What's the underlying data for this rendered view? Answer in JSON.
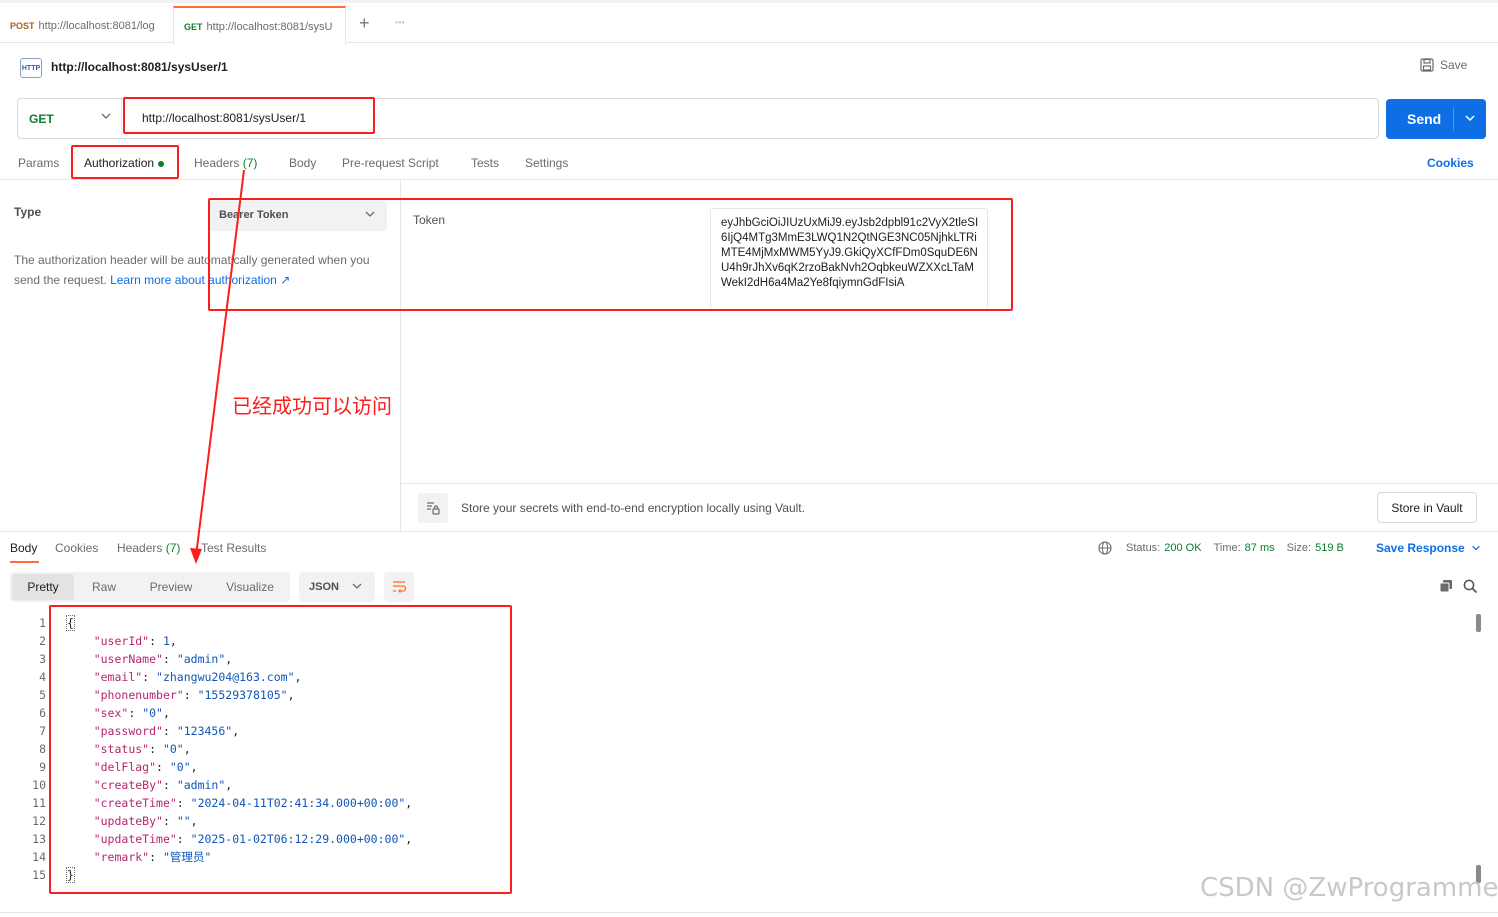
{
  "tabs": [
    {
      "method": "POST",
      "label": "http://localhost:8081/log",
      "method_color": "#a6631a"
    },
    {
      "method": "GET",
      "label": "http://localhost:8081/sysU",
      "method_color": "#0b7d2f"
    }
  ],
  "tab_add_label": "+",
  "tab_more_label": "◦◦◦",
  "header": {
    "icon_text": "HTTP",
    "title": "http://localhost:8081/sysUser/1",
    "save_label": "Save"
  },
  "request": {
    "method": "GET",
    "url": "http://localhost:8081/sysUser/1",
    "send_label": "Send"
  },
  "request_tabs": {
    "params": "Params",
    "authorization": "Authorization",
    "headers": "Headers",
    "headers_count": "(7)",
    "body": "Body",
    "prerequest": "Pre-request Script",
    "tests": "Tests",
    "settings": "Settings",
    "cookies": "Cookies"
  },
  "auth": {
    "type_label": "Type",
    "type_value": "Bearer Token",
    "description": "The authorization header will be automatically generated when you send the request.",
    "learn_more": "Learn more about authorization ↗",
    "token_label": "Token",
    "token_value": "eyJhbGciOiJIUzUxMiJ9.eyJsb2dpbl91c2VyX2tleSI6IjQ4MTg3MmE3LWQ1N2QtNGE3NC05NjhkLTRiMTE4MjMxMWM5YyJ9.GkiQyXCfFDm0SquDE6NU4h9rJhXv6qK2rzoBakNvh2OqbkeuWZXXcLTaMWekI2dH6a4Ma2Ye8fqiymnGdFIsiA"
  },
  "vault": {
    "text": "Store your secrets with end-to-end encryption locally using Vault.",
    "button": "Store in Vault"
  },
  "response_tabs": {
    "body": "Body",
    "cookies": "Cookies",
    "headers": "Headers",
    "headers_count": "(7)",
    "test_results": "Test Results"
  },
  "response_status": {
    "status_label": "Status:",
    "status_value": "200 OK",
    "time_label": "Time:",
    "time_value": "87 ms",
    "size_label": "Size:",
    "size_value": "519 B",
    "save_response": "Save Response"
  },
  "view_modes": {
    "pretty": "Pretty",
    "raw": "Raw",
    "preview": "Preview",
    "visualize": "Visualize",
    "format": "JSON"
  },
  "response_body": {
    "lines": [
      "1",
      "2",
      "3",
      "4",
      "5",
      "6",
      "7",
      "8",
      "9",
      "10",
      "11",
      "12",
      "13",
      "14",
      "15"
    ],
    "open": "{",
    "close": "}",
    "fields": [
      {
        "key": "\"userId\"",
        "value": "1",
        "type": "n",
        "comma": ","
      },
      {
        "key": "\"userName\"",
        "value": "\"admin\"",
        "type": "s",
        "comma": ","
      },
      {
        "key": "\"email\"",
        "value": "\"zhangwu204@163.com\"",
        "type": "s",
        "comma": ","
      },
      {
        "key": "\"phonenumber\"",
        "value": "\"15529378105\"",
        "type": "s",
        "comma": ","
      },
      {
        "key": "\"sex\"",
        "value": "\"0\"",
        "type": "s",
        "comma": ","
      },
      {
        "key": "\"password\"",
        "value": "\"123456\"",
        "type": "s",
        "comma": ","
      },
      {
        "key": "\"status\"",
        "value": "\"0\"",
        "type": "s",
        "comma": ","
      },
      {
        "key": "\"delFlag\"",
        "value": "\"0\"",
        "type": "s",
        "comma": ","
      },
      {
        "key": "\"createBy\"",
        "value": "\"admin\"",
        "type": "s",
        "comma": ","
      },
      {
        "key": "\"createTime\"",
        "value": "\"2024-04-11T02:41:34.000+00:00\"",
        "type": "s",
        "comma": ","
      },
      {
        "key": "\"updateBy\"",
        "value": "\"\"",
        "type": "s",
        "comma": ","
      },
      {
        "key": "\"updateTime\"",
        "value": "\"2025-01-02T06:12:29.000+00:00\"",
        "type": "s",
        "comma": ","
      },
      {
        "key": "\"remark\"",
        "value": "\"管理员\"",
        "type": "s",
        "comma": ""
      }
    ]
  },
  "annotation": {
    "text": "已经成功可以访问",
    "color": "#ff1c1c"
  },
  "watermark": "CSDN @ZwProgrammer"
}
